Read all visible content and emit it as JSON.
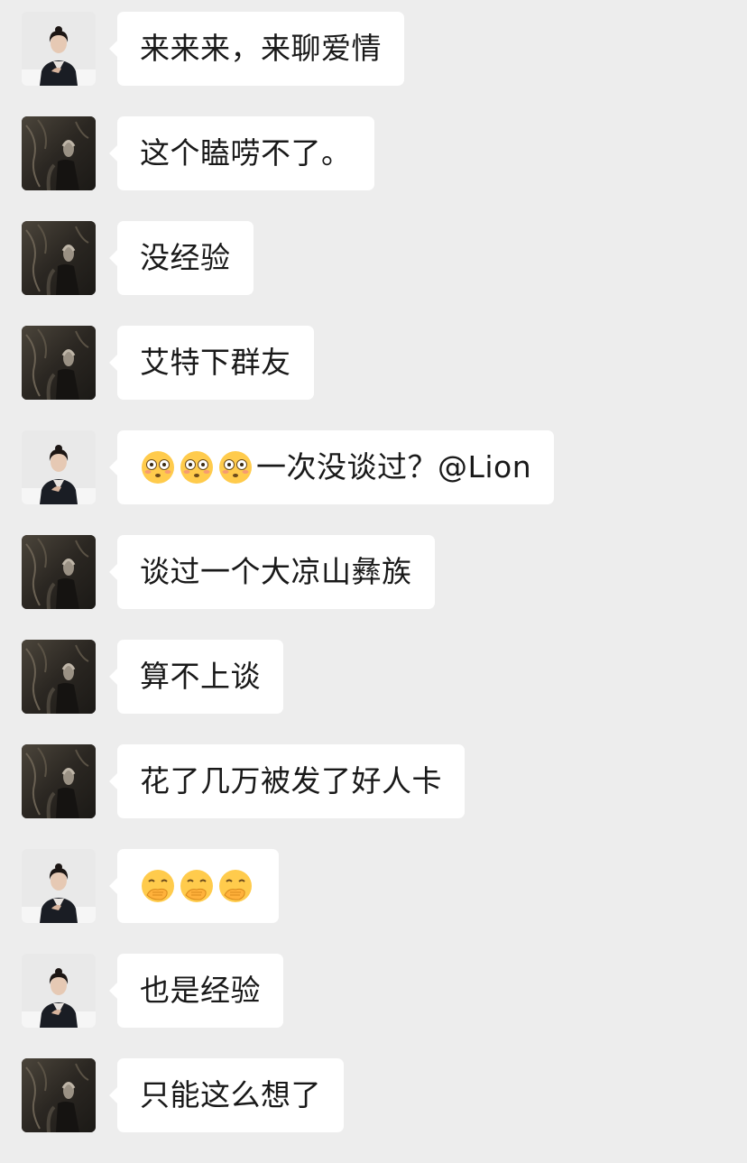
{
  "messages": [
    {
      "sender": "woman",
      "text": "来来来，来聊爱情"
    },
    {
      "sender": "man",
      "text": "这个瞌唠不了。"
    },
    {
      "sender": "man",
      "text": "没经验"
    },
    {
      "sender": "man",
      "text": "艾特下群友"
    },
    {
      "sender": "woman",
      "emoji": "flushed-face-icon",
      "emoji_count": 3,
      "text": "一次没谈过？@Lion"
    },
    {
      "sender": "man",
      "text": "谈过一个大凉山彝族"
    },
    {
      "sender": "man",
      "text": "算不上谈"
    },
    {
      "sender": "man",
      "text": "花了几万被发了好人卡"
    },
    {
      "sender": "woman",
      "emoji": "hand-over-mouth-face-icon",
      "emoji_count": 3,
      "text": ""
    },
    {
      "sender": "woman",
      "text": "也是经验"
    },
    {
      "sender": "man",
      "text": "只能这么想了"
    }
  ],
  "colors": {
    "background": "#ededed",
    "bubble": "#ffffff",
    "text": "#191919"
  }
}
